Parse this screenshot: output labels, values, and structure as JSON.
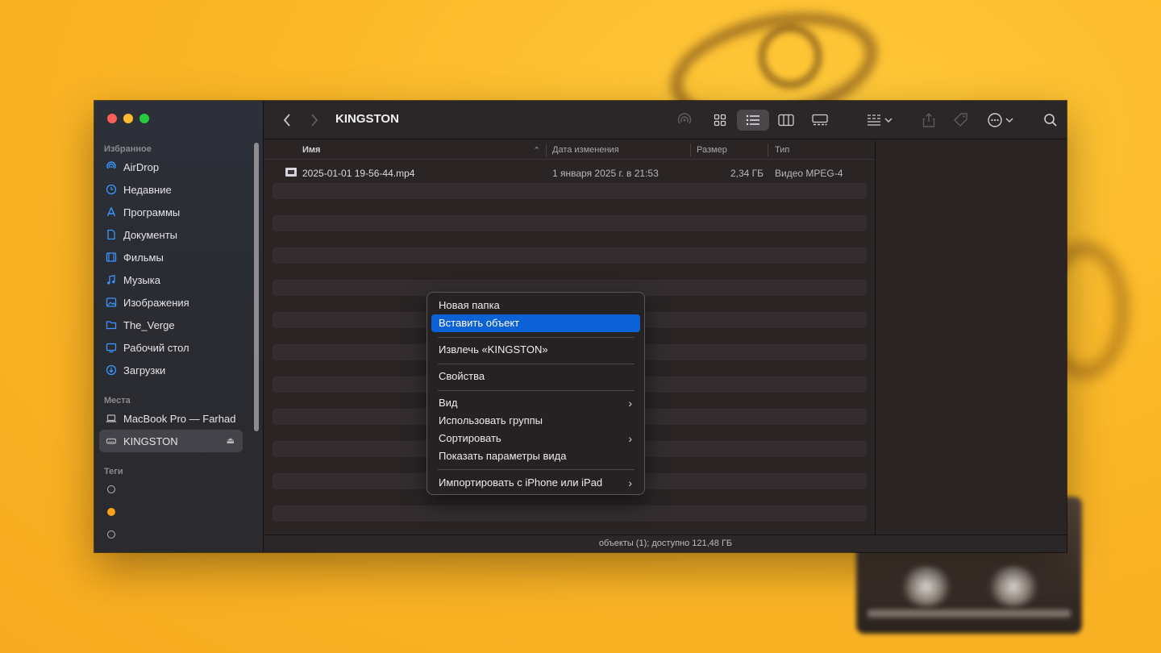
{
  "window": {
    "title": "KINGSTON"
  },
  "sidebar": {
    "favorites_header": "Избранное",
    "favorites": [
      {
        "label": "AirDrop",
        "icon": "airdrop-icon"
      },
      {
        "label": "Недавние",
        "icon": "clock-icon"
      },
      {
        "label": "Программы",
        "icon": "applications-icon"
      },
      {
        "label": "Документы",
        "icon": "document-icon"
      },
      {
        "label": "Фильмы",
        "icon": "film-icon"
      },
      {
        "label": "Музыка",
        "icon": "music-note-icon"
      },
      {
        "label": "Изображения",
        "icon": "photo-icon"
      },
      {
        "label": "The_Verge",
        "icon": "folder-icon"
      },
      {
        "label": "Рабочий стол",
        "icon": "desktop-icon"
      },
      {
        "label": "Загрузки",
        "icon": "download-icon"
      }
    ],
    "places_header": "Места",
    "places": [
      {
        "label": "MacBook Pro — Farhad",
        "icon": "laptop-icon"
      },
      {
        "label": "KINGSTON",
        "icon": "drive-icon",
        "selected": true,
        "eject": "⏏"
      }
    ],
    "tags_header": "Теги",
    "tags": [
      {
        "color": "hollow"
      },
      {
        "color": "#f7a21b"
      },
      {
        "color": "hollow"
      }
    ]
  },
  "columns": {
    "name": "Имя",
    "modified": "Дата изменения",
    "size": "Размер",
    "kind": "Тип"
  },
  "files": [
    {
      "name": "2025-01-01 19-56-44.mp4",
      "modified": "1 января 2025 г. в 21:53",
      "size": "2,34 ГБ",
      "kind": "Видео MPEG-4"
    }
  ],
  "status": {
    "text": "объекты (1); доступно 121,48 ГБ"
  },
  "context_menu": {
    "new_folder": "Новая папка",
    "paste_item": "Вставить объект",
    "eject": "Извлечь «KINGSTON»",
    "get_info": "Свойства",
    "view": "Вид",
    "use_groups": "Использовать группы",
    "sort_by": "Сортировать",
    "show_view_options": "Показать параметры вида",
    "import_from_iphone": "Импортировать с iPhone или iPad",
    "submenu_arrow": "›"
  },
  "colors": {
    "accent": "#3b95ff",
    "menu_highlight": "#0d61d6",
    "tag_orange": "#f7a21b"
  }
}
